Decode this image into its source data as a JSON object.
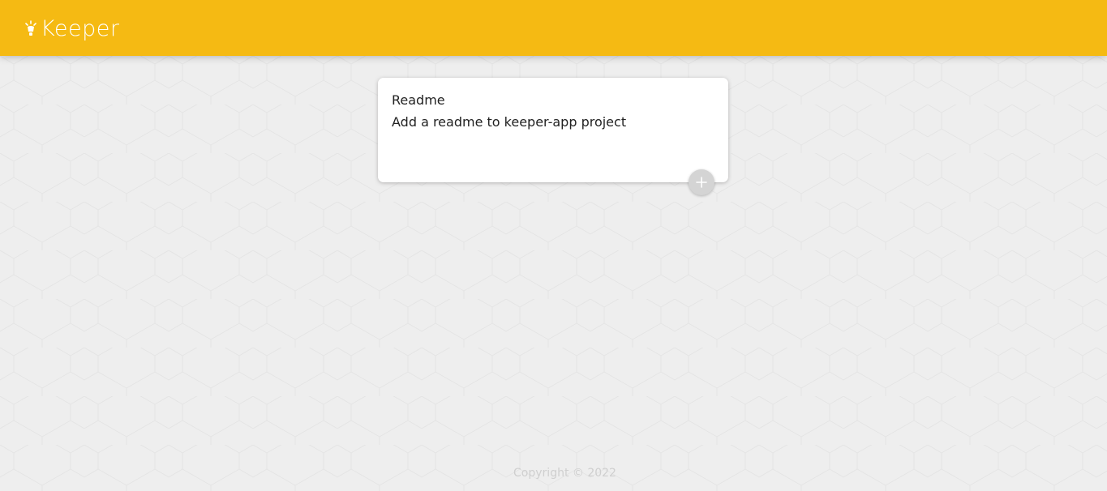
{
  "header": {
    "app_title": "Keeper",
    "logo_icon": "lightbulb-icon",
    "background_color": "#f5ba13"
  },
  "create_note": {
    "title_value": "Readme",
    "content_value": "Add a readme to keeper-app project",
    "add_button_icon": "plus-icon"
  },
  "footer": {
    "copyright_text": "Copyright © 2022"
  }
}
